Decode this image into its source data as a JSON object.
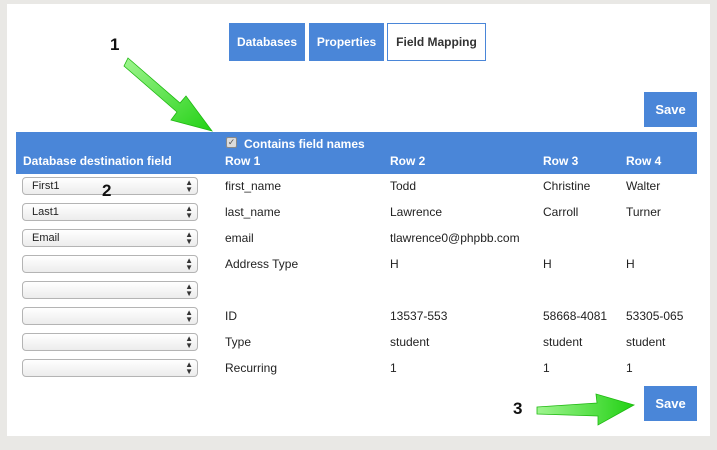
{
  "tabs": [
    {
      "label": "Databases",
      "active": false
    },
    {
      "label": "Properties",
      "active": false
    },
    {
      "label": "Field Mapping",
      "active": true
    }
  ],
  "save_label": "Save",
  "contains_field_names": {
    "label": "Contains field names",
    "checked": true
  },
  "columns": {
    "destination": "Database destination field",
    "row1": "Row 1",
    "row2": "Row 2",
    "row3": "Row 3",
    "row4": "Row 4"
  },
  "rows": [
    {
      "dest": "First1",
      "row1": "first_name",
      "row2": "Todd",
      "row3": "Christine",
      "row4": "Walter"
    },
    {
      "dest": "Last1",
      "row1": "last_name",
      "row2": "Lawrence",
      "row3": "Carroll",
      "row4": "Turner"
    },
    {
      "dest": "Email",
      "row1": "email",
      "row2": "tlawrence0@phpbb.com",
      "row3": "",
      "row4": ""
    },
    {
      "dest": "",
      "row1": "Address Type",
      "row2": "H",
      "row3": "H",
      "row4": "H"
    },
    {
      "dest": "",
      "row1": "",
      "row2": "",
      "row3": "",
      "row4": ""
    },
    {
      "dest": "",
      "row1": "ID",
      "row2": "13537-553",
      "row3": "58668-4081",
      "row4": "53305-065"
    },
    {
      "dest": "",
      "row1": "Type",
      "row2": "student",
      "row3": "student",
      "row4": "student"
    },
    {
      "dest": "",
      "row1": "Recurring",
      "row2": "1",
      "row3": "1",
      "row4": "1"
    }
  ],
  "callouts": [
    "1",
    "2",
    "3"
  ],
  "colors": {
    "accent": "#4a86d8",
    "arrow": "#2ee01c"
  }
}
